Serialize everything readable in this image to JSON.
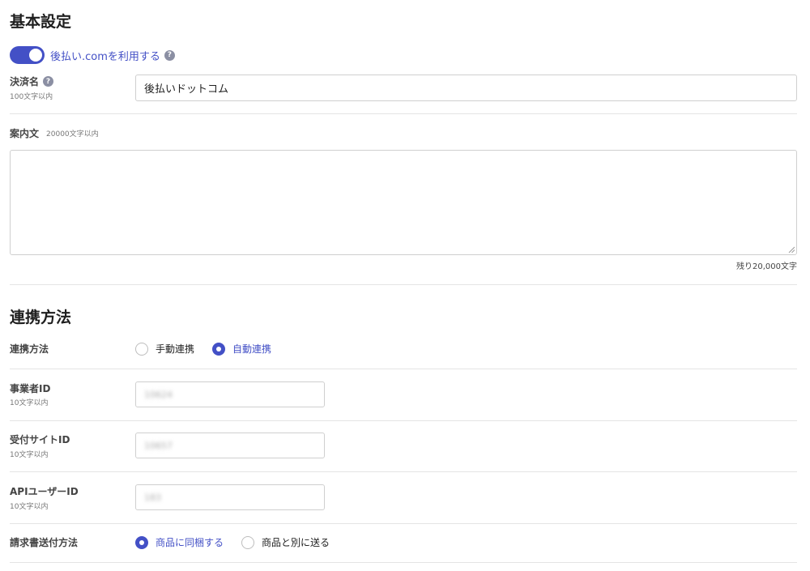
{
  "basic": {
    "title": "基本設定",
    "toggle_label": "後払い.comを利用する",
    "toggle_on": true,
    "help_glyph": "?"
  },
  "payment_name": {
    "label": "決済名",
    "limit": "100文字以内",
    "value": "後払いドットコム"
  },
  "guide_text": {
    "label": "案内文",
    "limit": "20000文字以内",
    "value": "",
    "remaining": "残り20,000文字"
  },
  "integration": {
    "title": "連携方法",
    "method_label": "連携方法",
    "options": [
      "手動連携",
      "自動連携"
    ],
    "selected": "自動連携"
  },
  "business_id": {
    "label": "事業者ID",
    "limit": "10文字以内",
    "value": "10624"
  },
  "site_id": {
    "label": "受付サイトID",
    "limit": "10文字以内",
    "value": "10657"
  },
  "api_user_id": {
    "label": "APIユーザーID",
    "limit": "10文字以内",
    "value": "183"
  },
  "invoice": {
    "label": "請求書送付方法",
    "options": [
      "商品に同梱する",
      "商品と別に送る"
    ],
    "selected": "商品に同梱する"
  },
  "colors": {
    "accent": "#4350c6",
    "border": "#cfcfcf",
    "divider": "#e4e4e4"
  }
}
